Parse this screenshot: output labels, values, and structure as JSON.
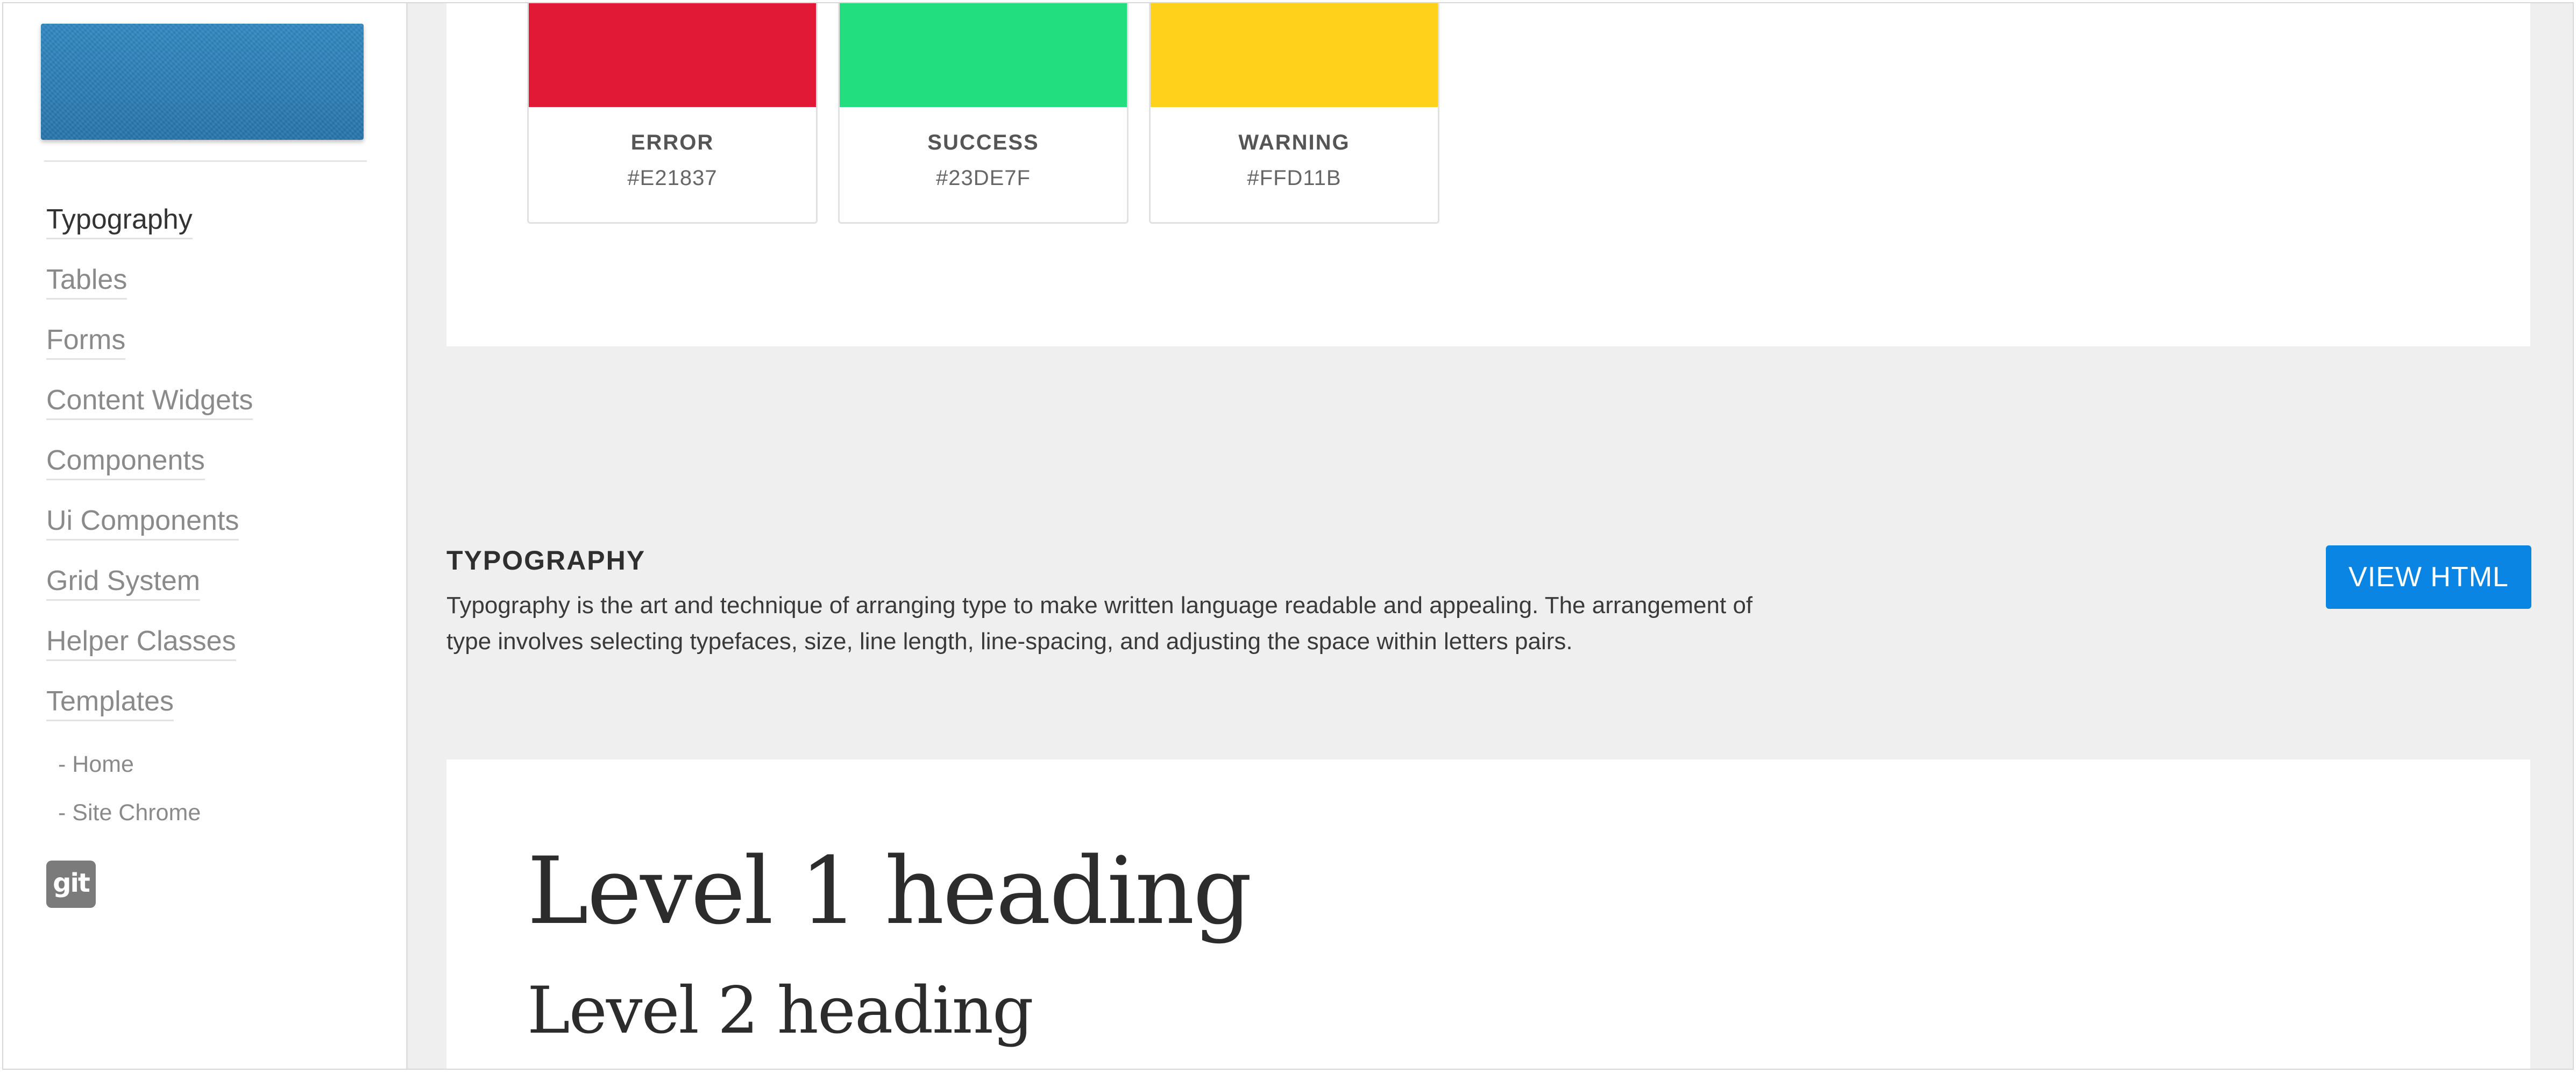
{
  "sidebar": {
    "nav": [
      {
        "label": "Typography",
        "active": true
      },
      {
        "label": "Tables",
        "active": false
      },
      {
        "label": "Forms",
        "active": false
      },
      {
        "label": "Content Widgets",
        "active": false
      },
      {
        "label": "Components",
        "active": false
      },
      {
        "label": "Ui Components",
        "active": false
      },
      {
        "label": "Grid System",
        "active": false
      },
      {
        "label": "Helper Classes",
        "active": false
      },
      {
        "label": "Templates",
        "active": false
      }
    ],
    "subnav": [
      {
        "label": "- Home"
      },
      {
        "label": "- Site Chrome"
      }
    ],
    "git_icon_label": "git",
    "logo_color": "#2B7DB5"
  },
  "colors": {
    "swatches": [
      {
        "name": "ERROR",
        "hex": "#E21837"
      },
      {
        "name": "SUCCESS",
        "hex": "#23DE7F"
      },
      {
        "name": "WARNING",
        "hex": "#FFD11B"
      }
    ]
  },
  "typography": {
    "title": "TYPOGRAPHY",
    "description": "Typography is the art and technique of arranging type to make written language readable and appealing. The arrangement of type involves selecting typefaces, size, line length, line-spacing, and adjusting the space within letters pairs.",
    "view_html_label": "VIEW HTML",
    "h1_sample": "Level 1 heading",
    "h2_sample": "Level 2 heading"
  },
  "theme": {
    "accent": "#0A85E4",
    "background": "#EFEFEF"
  }
}
